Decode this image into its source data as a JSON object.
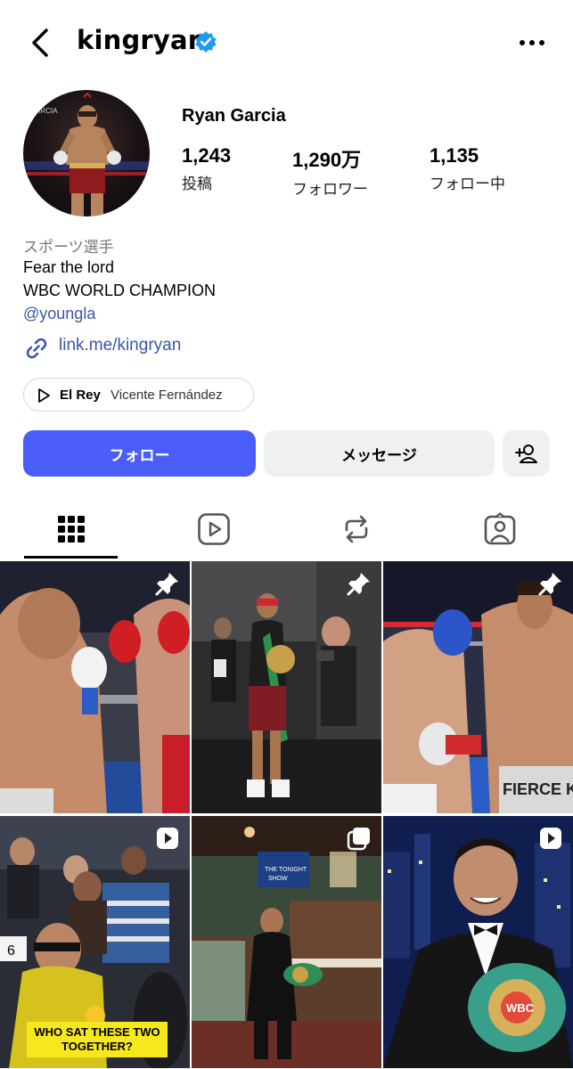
{
  "header": {
    "username": "kingryan",
    "back_icon": "chevron-left-icon",
    "verified_icon": "verified-badge-icon",
    "more_icon": "more-horizontal-icon"
  },
  "profile": {
    "full_name": "Ryan Garcia",
    "stats": [
      {
        "value": "1,243",
        "label": "投稿"
      },
      {
        "value": "1,290万",
        "label": "フォロワー"
      },
      {
        "value": "1,135",
        "label": "フォロー中"
      }
    ],
    "category": "スポーツ選手",
    "bio_line1": "Fear the lord",
    "bio_line2": "WBC WORLD CHAMPION",
    "mention": "@youngla",
    "link": "link.me/kingryan",
    "music": {
      "song": "El Rey",
      "artist": "Vicente Fernández"
    }
  },
  "actions": {
    "follow_label": "フォロー",
    "message_label": "メッセージ",
    "add_user_icon": "add-user-icon"
  },
  "tabs": [
    {
      "name": "grid",
      "icon": "grid-icon",
      "active": true
    },
    {
      "name": "reels",
      "icon": "reels-icon",
      "active": false
    },
    {
      "name": "reposts",
      "icon": "repost-icon",
      "active": false
    },
    {
      "name": "tagged",
      "icon": "tagged-icon",
      "active": false
    }
  ],
  "grid_posts": [
    {
      "badge": "pin-icon"
    },
    {
      "badge": "pin-icon"
    },
    {
      "badge": "pin-icon"
    },
    {
      "badge": "reel-icon",
      "caption": "WHO SAT THESE TWO TOGETHER?"
    },
    {
      "badge": "carousel-icon"
    },
    {
      "badge": "reel-icon"
    }
  ],
  "colors": {
    "accent": "#4a5df9",
    "link": "#3a56a8",
    "verified": "#1d9bf0",
    "button_bg": "#eff0f2"
  }
}
